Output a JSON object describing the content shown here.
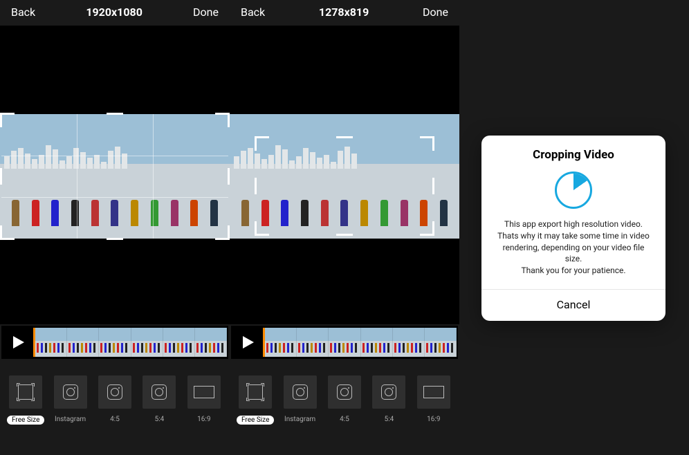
{
  "panels": [
    {
      "back": "Back",
      "resolution": "1920x1080",
      "done": "Done",
      "ratios": [
        {
          "label": "Free Size",
          "selected": true
        },
        {
          "label": "Instagram",
          "selected": false
        },
        {
          "label": "4:5",
          "selected": false
        },
        {
          "label": "5:4",
          "selected": false
        },
        {
          "label": "16:9",
          "selected": false
        }
      ]
    },
    {
      "back": "Back",
      "resolution": "1278x819",
      "done": "Done",
      "ratios": [
        {
          "label": "Free Size",
          "selected": true
        },
        {
          "label": "Instagram",
          "selected": false
        },
        {
          "label": "4:5",
          "selected": false
        },
        {
          "label": "5:4",
          "selected": false
        },
        {
          "label": "16:9",
          "selected": false
        }
      ]
    }
  ],
  "modal": {
    "title": "Cropping Video",
    "body_line1": "This app export high resolution video.",
    "body_line2": "Thats why it may take some time in video rendering, depending on your video file size.",
    "body_line3": "Thank you for your patience.",
    "cancel": "Cancel",
    "progress_deg": 55
  }
}
